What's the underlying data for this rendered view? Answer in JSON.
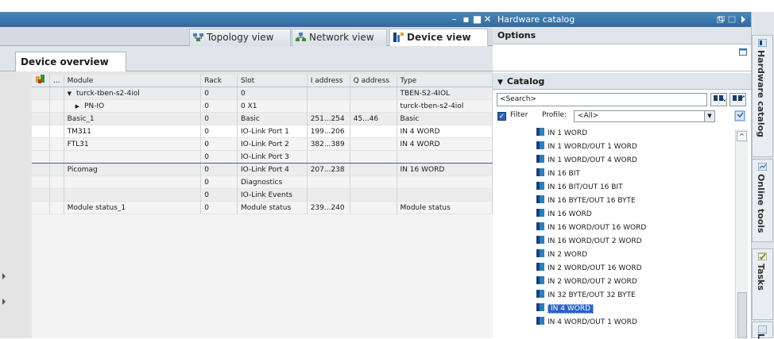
{
  "window_controls": [
    "–",
    "▪",
    "■",
    "✕"
  ],
  "view_tabs": [
    {
      "label": "Topology view",
      "icon": "topology-view-icon"
    },
    {
      "label": "Network view",
      "icon": "network-view-icon"
    },
    {
      "label": "Device view",
      "icon": "device-view-icon",
      "active": true
    }
  ],
  "device_overview": {
    "tab_label": "Device overview",
    "columns": [
      "",
      "...",
      "Module",
      "Rack",
      "Slot",
      "I address",
      "Q address",
      "Type"
    ],
    "rows": [
      {
        "module": "turck-tben-s2-4iol",
        "expander": "▼",
        "rack": "0",
        "slot": "0",
        "i_address": "",
        "q_address": "",
        "type": "TBEN-S2-4IOL"
      },
      {
        "module": "PN-IO",
        "expander": "▶",
        "rack": "0",
        "slot": "0 X1",
        "i_address": "",
        "q_address": "",
        "type": "turck-tben-s2-4iol"
      },
      {
        "module": "Basic_1",
        "rack": "0",
        "slot": "Basic",
        "i_address": "251...254",
        "q_address": "45...46",
        "type": "Basic"
      },
      {
        "module": "TM311",
        "rack": "0",
        "slot": "IO-Link Port 1",
        "i_address": "199...206",
        "q_address": "",
        "type": "IN 4 WORD"
      },
      {
        "module": "FTL31",
        "rack": "0",
        "slot": "IO-Link Port 2",
        "i_address": "382...389",
        "q_address": "",
        "type": "IN 4 WORD"
      },
      {
        "module": "",
        "rack": "0",
        "slot": "IO-Link Port 3",
        "i_address": "",
        "q_address": "",
        "type": ""
      },
      {
        "module": "Picomag",
        "rack": "0",
        "slot": "IO-Link Port 4",
        "i_address": "207...238",
        "q_address": "",
        "type": "IN 16 WORD"
      },
      {
        "module": "",
        "rack": "0",
        "slot": "Diagnostics",
        "i_address": "",
        "q_address": "",
        "type": ""
      },
      {
        "module": "",
        "rack": "0",
        "slot": "IO-Link Events",
        "i_address": "",
        "q_address": "",
        "type": ""
      },
      {
        "module": "Module status_1",
        "rack": "0",
        "slot": "Module status",
        "i_address": "239...240",
        "q_address": "",
        "type": "Module status"
      }
    ]
  },
  "hardware_catalog": {
    "title": "Hardware catalog",
    "options_label": "Options",
    "catalog_label": "Catalog",
    "search_placeholder": "<Search>",
    "filter_label": "Filter",
    "profile_label": "Profile:",
    "profile_value": "<All>",
    "items": [
      {
        "label": "IN 1 WORD"
      },
      {
        "label": "IN 1 WORD/OUT 1 WORD"
      },
      {
        "label": "IN 1 WORD/OUT 4 WORD"
      },
      {
        "label": "IN 16 BIT"
      },
      {
        "label": "IN 16 BIT/OUT 16 BIT"
      },
      {
        "label": "IN 16 BYTE/OUT 16 BYTE"
      },
      {
        "label": "IN 16 WORD"
      },
      {
        "label": "IN 16 WORD/OUT 16 WORD"
      },
      {
        "label": "IN 16 WORD/OUT 2 WORD"
      },
      {
        "label": "IN 2 WORD"
      },
      {
        "label": "IN 2 WORD/OUT 16 WORD"
      },
      {
        "label": "IN 2 WORD/OUT 2 WORD"
      },
      {
        "label": "IN 32 BYTE/OUT 32 BYTE"
      },
      {
        "label": "IN 4 WORD",
        "selected": true
      },
      {
        "label": "IN 4 WORD/OUT 1 WORD"
      }
    ]
  },
  "side_tabs": [
    {
      "label": "Hardware catalog"
    },
    {
      "label": "Online tools"
    },
    {
      "label": "Tasks"
    },
    {
      "label": "L"
    }
  ]
}
